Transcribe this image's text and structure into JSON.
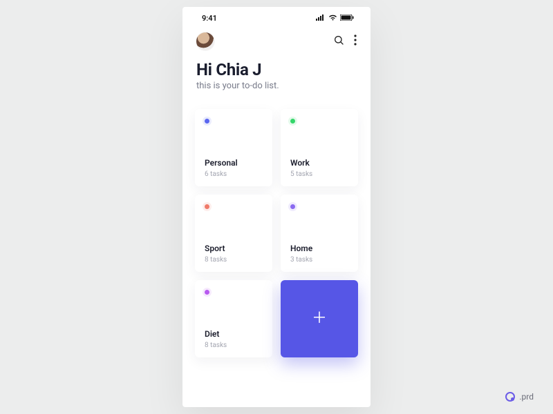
{
  "status": {
    "time": "9:41"
  },
  "greeting": {
    "line1": "Hi Chia J",
    "line2": "this is your to-do list."
  },
  "cards": [
    {
      "name": "Personal",
      "count": "6 tasks",
      "color": "#5a66f0"
    },
    {
      "name": "Work",
      "count": "5 tasks",
      "color": "#34d66a"
    },
    {
      "name": "Sport",
      "count": "8 tasks",
      "color": "#f07a6a"
    },
    {
      "name": "Home",
      "count": "3 tasks",
      "color": "#8a6af0"
    },
    {
      "name": "Diet",
      "count": "8 tasks",
      "color": "#b85af0"
    }
  ],
  "brand": {
    "label": ".prd"
  }
}
